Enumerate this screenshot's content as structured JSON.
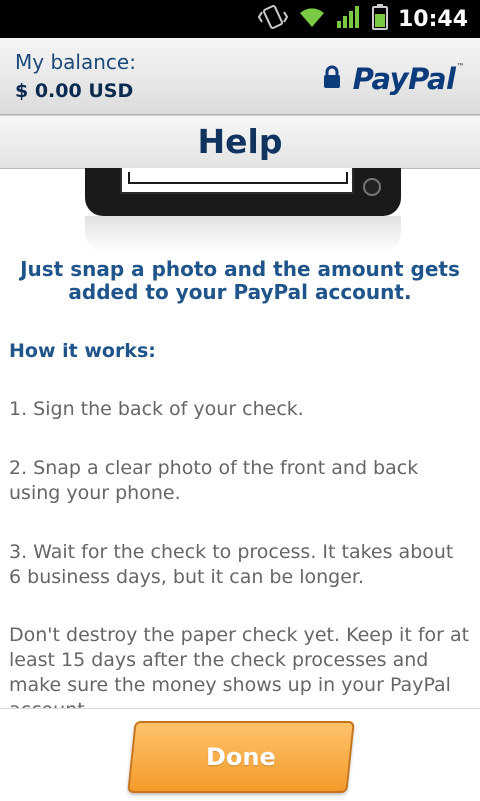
{
  "status_bar": {
    "time": "10:44",
    "icons": [
      "vibrate-icon",
      "wifi-icon",
      "signal-icon",
      "battery-icon"
    ]
  },
  "header": {
    "balance_label": "My balance:",
    "balance_value": "$ 0.00 USD",
    "brand": "PayPal",
    "brand_tm": "™",
    "brand_color": "#0b3b7a"
  },
  "page": {
    "title": "Help"
  },
  "content": {
    "headline": "Just snap a photo and the amount gets added to your PayPal account.",
    "section_title": "How it works:",
    "steps": [
      "1. Sign the back of your check.",
      "2. Snap a clear photo of the front and back using your phone.",
      "3. Wait for the check to process. It takes about 6 business days, but it can be longer."
    ],
    "note": "Don't destroy the paper check yet. Keep it for at least 15 days after the check processes and make sure the money shows up in your PayPal account."
  },
  "footer": {
    "done_label": "Done",
    "done_color": "#f39b2a"
  }
}
